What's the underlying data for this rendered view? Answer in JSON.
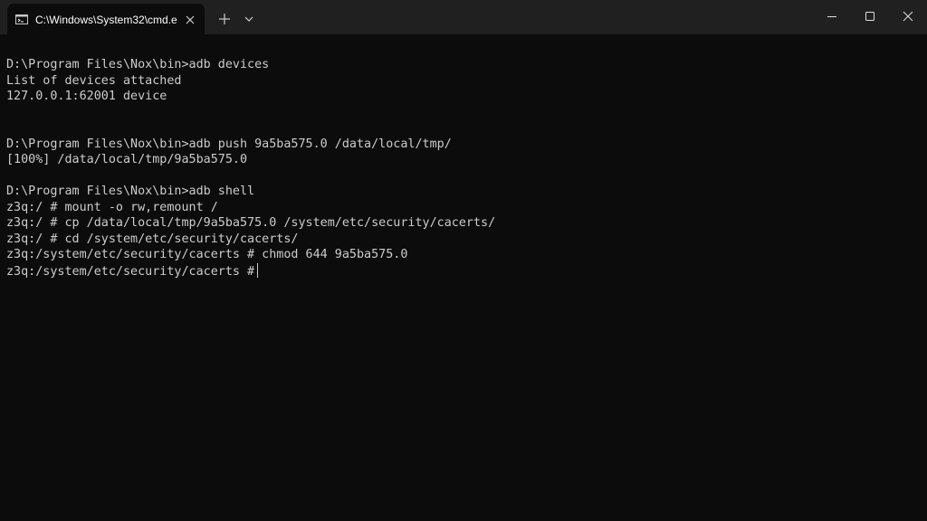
{
  "tab": {
    "title": "C:\\Windows\\System32\\cmd.e",
    "icon": "cmd-icon"
  },
  "titlebar_buttons": {
    "new_tab_icon": "plus-icon",
    "dropdown_icon": "chevron-down-icon",
    "minimize_icon": "minimize-icon",
    "maximize_icon": "maximize-icon",
    "close_icon": "close-icon"
  },
  "colors": {
    "terminal_bg": "#0c0c0c",
    "titlebar_bg": "#202020",
    "text": "#cccccc"
  },
  "console": {
    "lines": [
      "D:\\Program Files\\Nox\\bin>adb devices",
      "List of devices attached",
      "127.0.0.1:62001 device",
      "",
      "",
      "D:\\Program Files\\Nox\\bin>adb push 9a5ba575.0 /data/local/tmp/",
      "[100%] /data/local/tmp/9a5ba575.0",
      "",
      "D:\\Program Files\\Nox\\bin>adb shell",
      "z3q:/ # mount -o rw,remount /",
      "z3q:/ # cp /data/local/tmp/9a5ba575.0 /system/etc/security/cacerts/",
      "z3q:/ # cd /system/etc/security/cacerts/",
      "z3q:/system/etc/security/cacerts # chmod 644 9a5ba575.0",
      "z3q:/system/etc/security/cacerts #"
    ]
  }
}
